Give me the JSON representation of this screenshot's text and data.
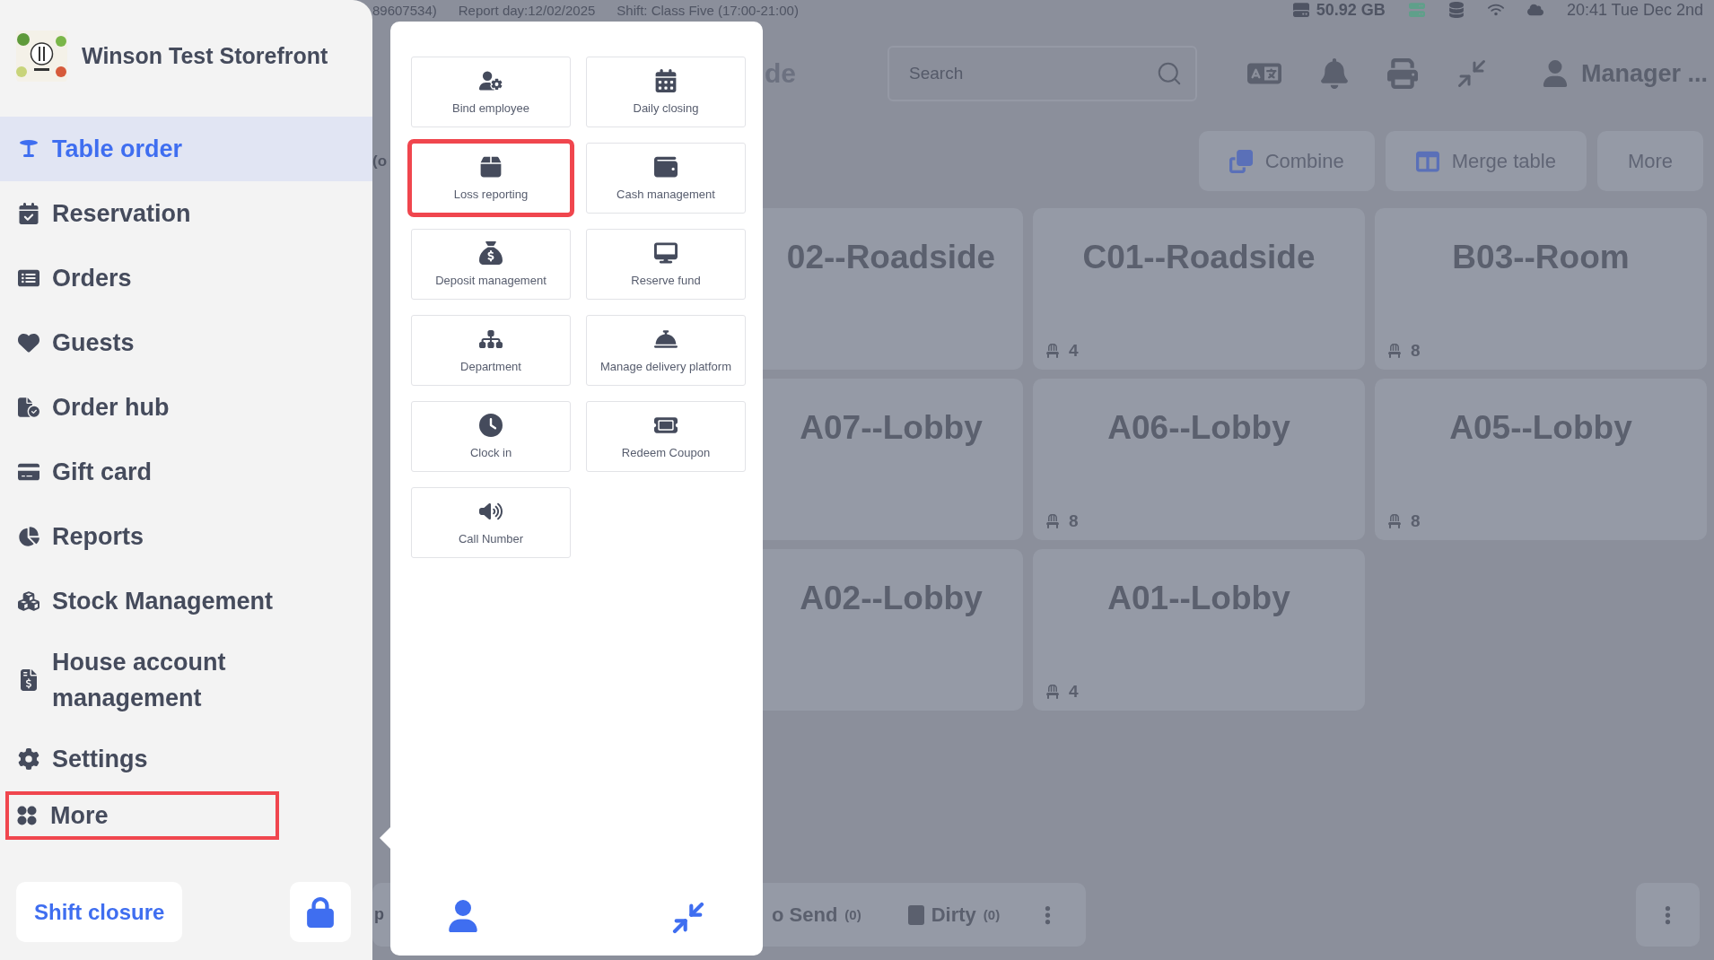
{
  "sidebar": {
    "store_name": "Winson Test Storefront",
    "items": [
      {
        "label": "Table order",
        "selected": true,
        "highlighted": false
      },
      {
        "label": "Reservation",
        "selected": false,
        "highlighted": false
      },
      {
        "label": "Orders",
        "selected": false,
        "highlighted": false
      },
      {
        "label": "Guests",
        "selected": false,
        "highlighted": false
      },
      {
        "label": "Order hub",
        "selected": false,
        "highlighted": false
      },
      {
        "label": "Gift card",
        "selected": false,
        "highlighted": false
      },
      {
        "label": "Reports",
        "selected": false,
        "highlighted": false
      },
      {
        "label": "Stock Management",
        "selected": false,
        "highlighted": false
      },
      {
        "label": "House account management",
        "selected": false,
        "highlighted": false
      },
      {
        "label": "Settings",
        "selected": false,
        "highlighted": false
      },
      {
        "label": "More",
        "selected": false,
        "highlighted": true
      }
    ],
    "shift_button": "Shift closure"
  },
  "status_bar": {
    "order_fragment": "89607534)",
    "report_day": "Report day:12/02/2025",
    "shift": "Shift:  Class Five (17:00-21:00)",
    "storage": "50.92 GB",
    "datetime": "20:41 Tue Dec 2nd"
  },
  "header": {
    "tab_fragment": "de",
    "search": {
      "placeholder": "Search"
    },
    "user": "Manager ..."
  },
  "actions": {
    "fragment": "(o",
    "buttons": [
      "Combine",
      "Merge table",
      "More"
    ]
  },
  "tables": [
    {
      "name": "02--Roadside"
    },
    {
      "name": "C01--Roadside",
      "seats": "4"
    },
    {
      "name": "B03--Room",
      "seats": "8"
    },
    {
      "name": "A07--Lobby"
    },
    {
      "name": "A06--Lobby",
      "seats": "8"
    },
    {
      "name": "A05--Lobby",
      "seats": "8"
    },
    {
      "name": "A02--Lobby"
    },
    {
      "name": "A01--Lobby",
      "seats": "4"
    }
  ],
  "bottom_bar": {
    "fragment": "p",
    "statuses": [
      {
        "label": "o Send",
        "count": "(0)"
      },
      {
        "label": "Dirty",
        "count": "(0)",
        "color": "#5b606e"
      }
    ]
  },
  "popup": {
    "items": [
      {
        "label": "Bind employee",
        "highlighted": false
      },
      {
        "label": "Daily closing",
        "highlighted": false
      },
      {
        "label": "Loss reporting",
        "highlighted": true
      },
      {
        "label": "Cash management",
        "highlighted": false
      },
      {
        "label": "Deposit management",
        "highlighted": false
      },
      {
        "label": "Reserve fund",
        "highlighted": false
      },
      {
        "label": "Department",
        "highlighted": false
      },
      {
        "label": "Manage delivery platform",
        "highlighted": false
      },
      {
        "label": "Clock in",
        "highlighted": false
      },
      {
        "label": "Redeem Coupon",
        "highlighted": false
      },
      {
        "label": "Call Number",
        "highlighted": false
      }
    ]
  }
}
